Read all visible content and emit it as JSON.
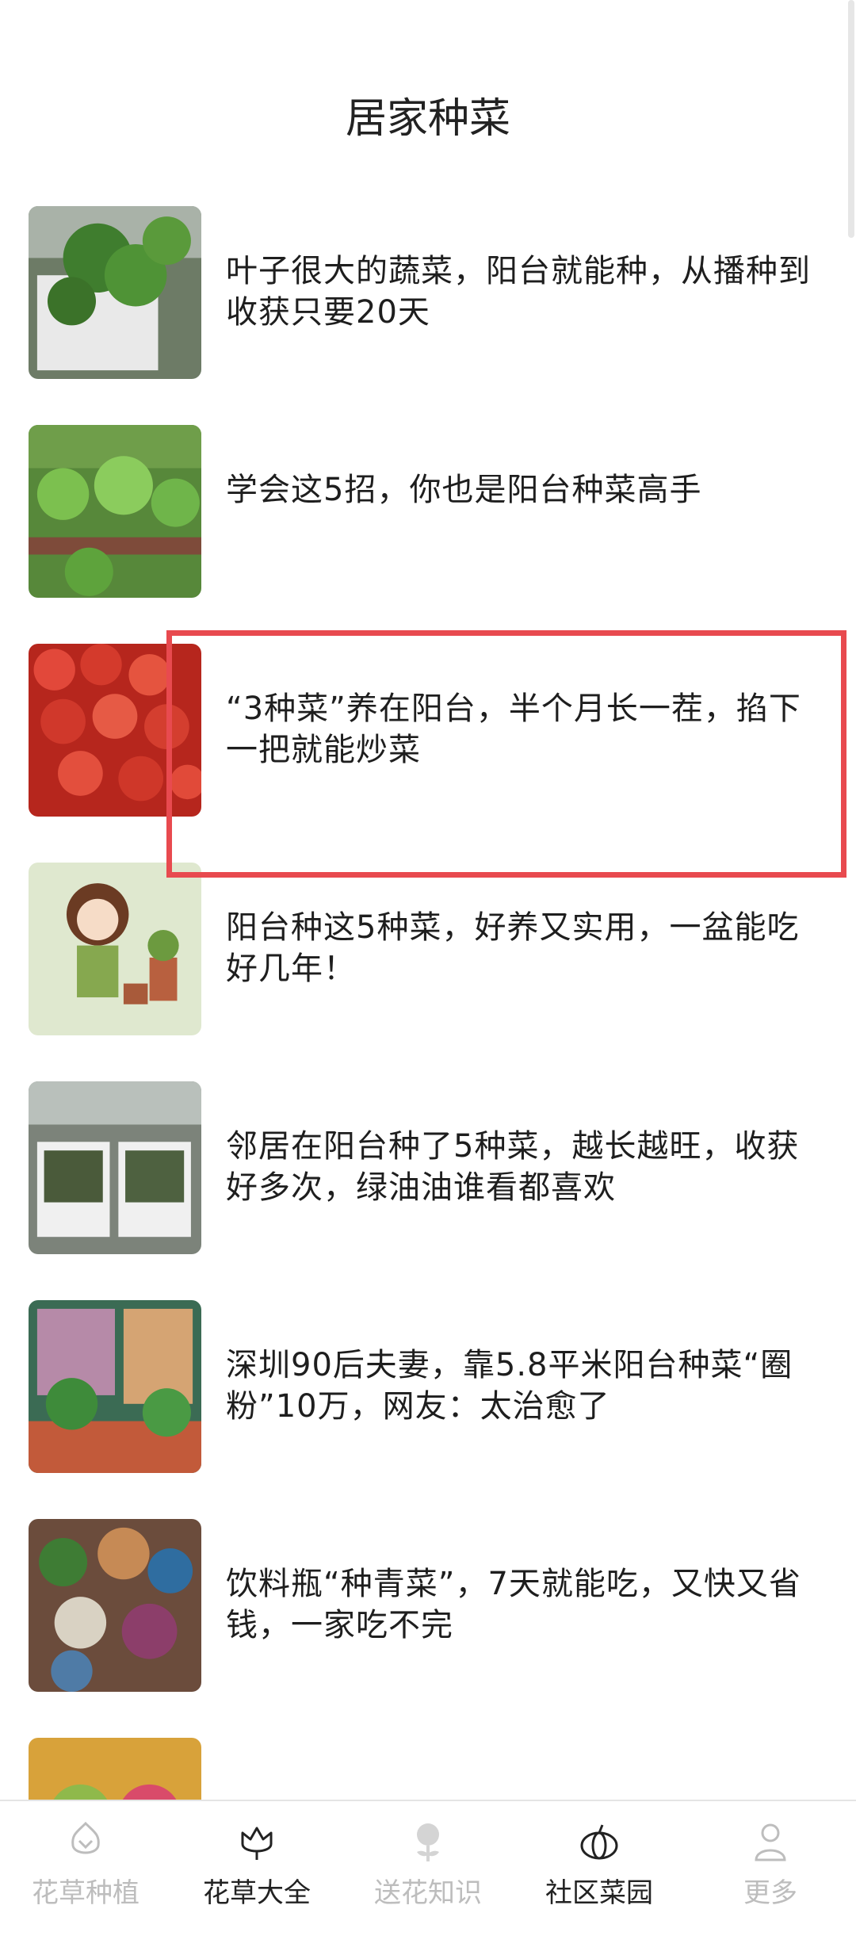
{
  "header": {
    "title": "居家种菜"
  },
  "articles": [
    {
      "title": "叶子很大的蔬菜，阳台就能种，从播种到收获只要20天"
    },
    {
      "title": "学会这5招，你也是阳台种菜高手"
    },
    {
      "title": "“3种菜”养在阳台，半个月长一茬，掐下一把就能炒菜"
    },
    {
      "title": "阳台种这5种菜，好养又实用，一盆能吃好几年！"
    },
    {
      "title": "邻居在阳台种了5种菜，越长越旺，收获好多次，绿油油谁看都喜欢"
    },
    {
      "title": "深圳90后夫妻，靠5.8平米阳台种菜“圈粉”10万，网友：太治愈了"
    },
    {
      "title": "饮料瓶“种青菜”，7天就能吃，又快又省钱，一家吃不完"
    },
    {
      "title": ""
    }
  ],
  "tabbar": {
    "tabs": [
      {
        "label": "花草种植",
        "icon": "flower-icon"
      },
      {
        "label": "花草大全",
        "icon": "lotus-icon"
      },
      {
        "label": "送花知识",
        "icon": "rose-icon"
      },
      {
        "label": "社区菜园",
        "icon": "pumpkin-icon"
      },
      {
        "label": "更多",
        "icon": "person-icon"
      }
    ]
  },
  "colors": {
    "highlight": "#e84a4f",
    "tab_inactive": "#bdbdbd",
    "tab_active": "#222222"
  }
}
